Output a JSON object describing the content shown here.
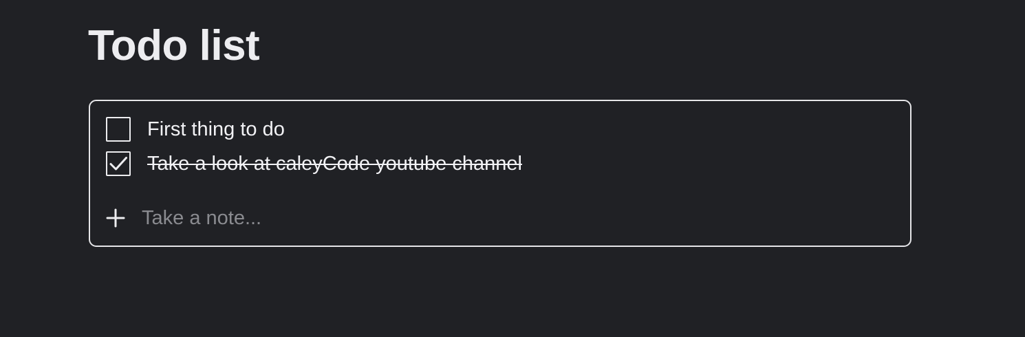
{
  "page": {
    "title": "Todo list"
  },
  "todos": [
    {
      "label": "First thing to do",
      "checked": false
    },
    {
      "label": "Take a look at caleyCode youtube channel",
      "checked": true
    }
  ],
  "add_note": {
    "placeholder": "Take a note...",
    "icon": "plus-icon"
  },
  "colors": {
    "background": "#202125",
    "text": "#ededf0",
    "border": "#e6e6e9",
    "placeholder": "#8a8b90"
  }
}
